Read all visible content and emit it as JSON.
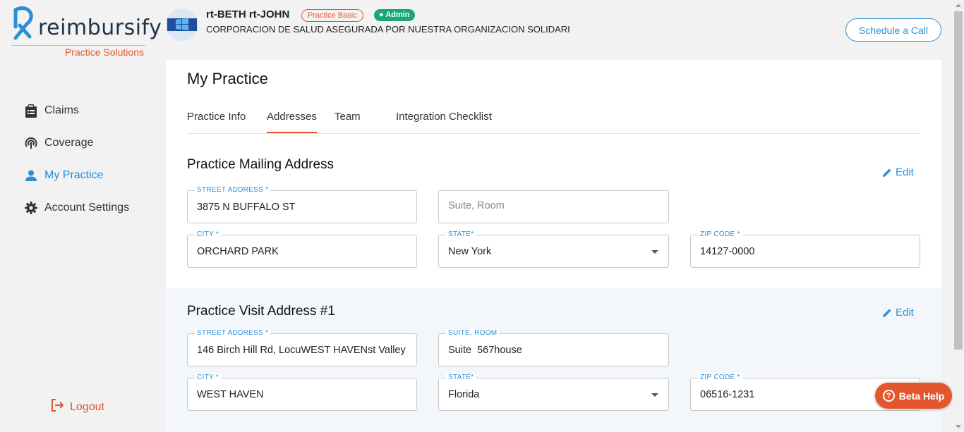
{
  "brand": {
    "name": "reimbursify",
    "subtitle": "Practice Solutions",
    "accent": "#e4572e",
    "primary": "#2b8fd6"
  },
  "sidebar": {
    "items": [
      {
        "label": "Claims",
        "icon": "clipboard-icon"
      },
      {
        "label": "Coverage",
        "icon": "coverage-icon"
      },
      {
        "label": "My Practice",
        "icon": "person-icon",
        "active": true
      },
      {
        "label": "Account Settings",
        "icon": "gear-icon"
      }
    ],
    "logout": "Logout"
  },
  "header": {
    "user_name": "rt-BETH rt-JOHN",
    "plan_badge": "Practice Basic",
    "role_badge": "Admin",
    "organization": "CORPORACION DE SALUD ASEGURADA POR NUESTRA ORGANIZACION SOLIDARI",
    "schedule_button": "Schedule a Call"
  },
  "page": {
    "title": "My Practice",
    "tabs": [
      "Practice Info",
      "Addresses",
      "Team",
      "Integration Checklist"
    ],
    "active_tab": "Addresses"
  },
  "mailing": {
    "title": "Practice Mailing Address",
    "edit": "Edit",
    "street_label": "STREET ADDRESS *",
    "street_value": "3875 N BUFFALO ST",
    "suite_placeholder": "Suite, Room",
    "city_label": "CITY *",
    "city_value": "ORCHARD PARK",
    "state_label": "STATE*",
    "state_value": "New York",
    "zip_label": "ZIP CODE *",
    "zip_value": "14127-0000"
  },
  "visit": {
    "title": "Practice Visit Address #1",
    "edit": "Edit",
    "street_label": "STREET ADDRESS *",
    "street_value": "146 Birch Hill Rd, LocuWEST HAVENst Valley",
    "suite_label": "SUITE, ROOM",
    "suite_value": "Suite  567house",
    "city_label": "CITY *",
    "city_value": "WEST HAVEN",
    "state_label": "STATE*",
    "state_value": "Florida",
    "zip_label": "ZIP CODE *",
    "zip_value": "06516-1231"
  },
  "beta_help": "Beta Help"
}
